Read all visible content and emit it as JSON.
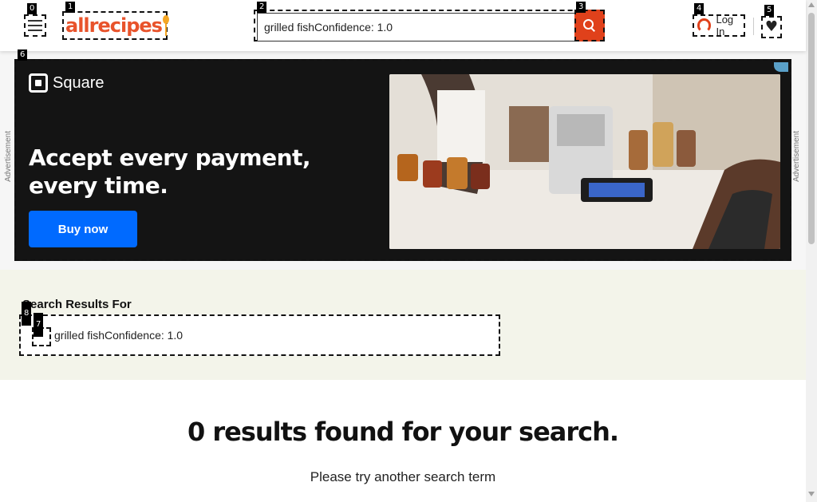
{
  "header": {
    "logo_text": "allrecipes",
    "search_value": "grilled fishConfidence: 1.0",
    "login_label": "Log In"
  },
  "ad": {
    "side_label": "Advertisement",
    "brand_name": "Square",
    "headline": "Accept every payment, every time.",
    "button_label": "Buy now"
  },
  "results": {
    "label": "Search Results For",
    "query": "grilled fishConfidence: 1.0",
    "none_found": "0 results found for your search.",
    "suggestion": "Please try another search term"
  },
  "tags": [
    "0",
    "1",
    "2",
    "3",
    "4",
    "5",
    "6",
    "7",
    "8"
  ],
  "colors": {
    "brand_orange": "#e0411b",
    "ad_button_blue": "#006aff",
    "results_bg": "#f3f4ea"
  }
}
